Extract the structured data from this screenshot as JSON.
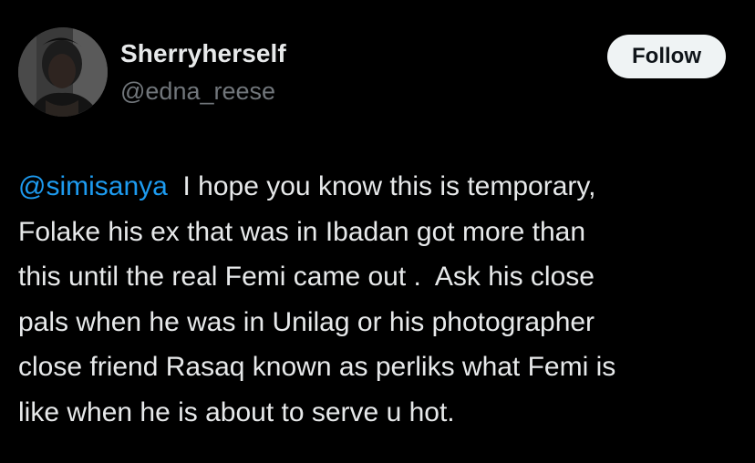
{
  "user": {
    "display_name": "Sherryherself",
    "handle": "@edna_reese",
    "avatar_icon": "profile-photo"
  },
  "actions": {
    "follow_label": "Follow"
  },
  "tweet": {
    "mention": "@simisanya",
    "text": "  I hope you know this is temporary,\nFolake his ex that was in Ibadan got more than\nthis until the real Femi came out .  Ask his close\npals when he was in Unilag or his photographer\nclose friend Rasaq known as perliks what Femi is\nlike when he is about to serve u hot."
  },
  "colors": {
    "background": "#000000",
    "text_primary": "#e7e9ea",
    "text_secondary": "#71767b",
    "link": "#1d9bf0",
    "button_bg": "#eff3f4",
    "button_text": "#0f1419"
  }
}
